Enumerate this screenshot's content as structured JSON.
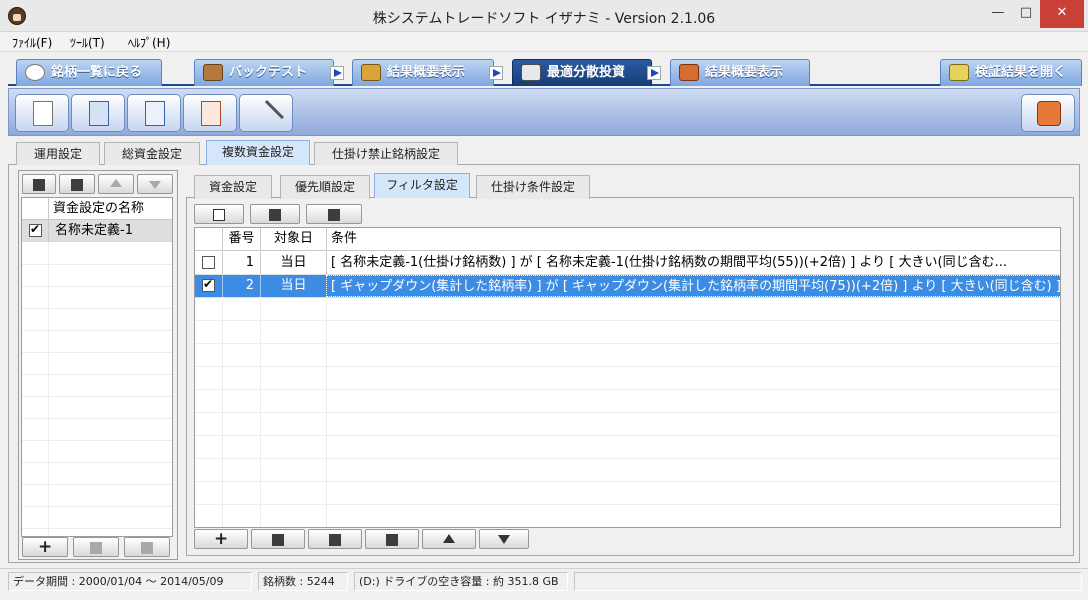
{
  "window": {
    "title": "株システムトレードソフト イザナミ - Version 2.1.06",
    "minimize": "—",
    "maximize": "□",
    "close": "✕"
  },
  "menu": {
    "file": "ﾌｧｲﾙ(F)",
    "tool": "ﾂｰﾙ(T)",
    "help": "ﾍﾙﾌﾟ(H)"
  },
  "nav": {
    "back": "銘柄一覧に戻る",
    "backtest": "バックテスト",
    "result1": "結果概要表示",
    "optimize": "最適分散投資",
    "result2": "結果概要表示",
    "open_results": "検証結果を開く"
  },
  "tabs_main": [
    "運用設定",
    "総資金設定",
    "複数資金設定",
    "仕掛け禁止銘柄設定"
  ],
  "tabs_sub": [
    "資金設定",
    "優先順設定",
    "フィルタ設定",
    "仕掛け条件設定"
  ],
  "left_list": {
    "header": "資金設定の名称",
    "rows": [
      {
        "checked": true,
        "name": "名称未定義-1"
      }
    ]
  },
  "filter_table": {
    "headers": {
      "no": "番号",
      "date": "対象日",
      "condition": "条件"
    },
    "rows": [
      {
        "checked": false,
        "no": "1",
        "date": "当日",
        "condition": "[ 名称未定義-1(仕掛け銘柄数) ] が [ 名称未定義-1(仕掛け銘柄数の期間平均(55))(+2倍) ] より [ 大きい(同じ含む..."
      },
      {
        "checked": true,
        "no": "2",
        "date": "当日",
        "condition": "[ ギャップダウン(集計した銘柄率) ] が [ ギャップダウン(集計した銘柄率の期間平均(75))(+2倍) ] より [ 大きい(同じ含む) ]"
      }
    ]
  },
  "status": {
    "period": "データ期間 : 2000/01/04 ～ 2014/05/09",
    "count": "銘柄数 : 5244",
    "drive": "(D:) ドライブの空き容量 : 約 351.8 GB"
  },
  "colors": {
    "nav_active": "#1f4a90",
    "selected_row": "#3b8ce2",
    "tab_selected": "#d6e6fa",
    "close_button": "#c94036"
  }
}
